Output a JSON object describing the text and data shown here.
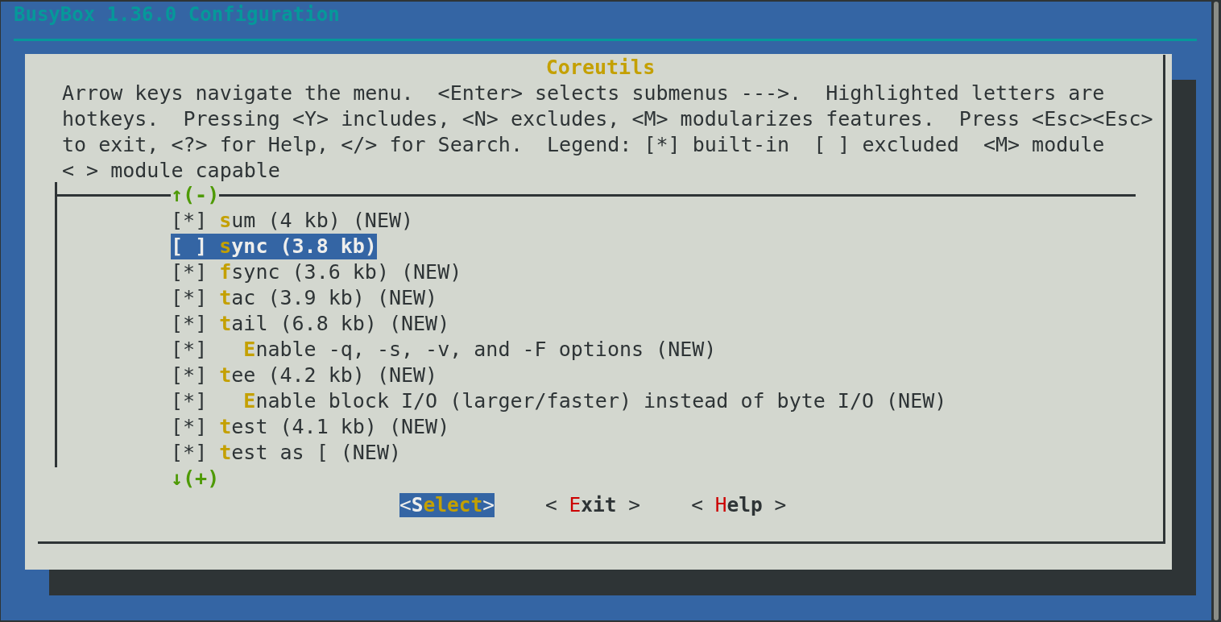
{
  "window": {
    "title": "BusyBox 1.36.0 Configuration"
  },
  "dialog": {
    "title": "Coreutils",
    "help": [
      "Arrow keys navigate the menu.  <Enter> selects submenus --->.  Highlighted letters are",
      "hotkeys.  Pressing <Y> includes, <N> excludes, <M> modularizes features.  Press <Esc><Esc>",
      "to exit, <?> for Help, </> for Search.  Legend: [*] built-in  [ ] excluded  <M> module",
      "< > module capable"
    ]
  },
  "menu": {
    "scroll_up": "↑(-)",
    "scroll_down": "↓(+)",
    "items": [
      {
        "box": "[*]",
        "checked": true,
        "label": "sum (4 kb) (NEW)",
        "selected": false
      },
      {
        "box": "[ ]",
        "checked": false,
        "label": "sync (3.8 kb)",
        "selected": true
      },
      {
        "box": "[*]",
        "checked": true,
        "label": "fsync (3.6 kb) (NEW)",
        "selected": false
      },
      {
        "box": "[*]",
        "checked": true,
        "label": "tac (3.9 kb) (NEW)",
        "selected": false
      },
      {
        "box": "[*]",
        "checked": true,
        "label": "tail (6.8 kb) (NEW)",
        "selected": false,
        "children": [
          {
            "box": "[*]",
            "checked": true,
            "label": "Enable -q, -s, -v, and -F options (NEW)",
            "selected": false
          }
        ]
      },
      {
        "box": "[*]",
        "checked": true,
        "label": "tee (4.2 kb) (NEW)",
        "selected": false,
        "children": [
          {
            "box": "[*]",
            "checked": true,
            "label": "Enable block I/O (larger/faster) instead of byte I/O (NEW)",
            "selected": false
          }
        ]
      },
      {
        "box": "[*]",
        "checked": true,
        "label": "test (4.1 kb) (NEW)",
        "selected": false
      },
      {
        "box": "[*]",
        "checked": true,
        "label": "test as [ (NEW)",
        "selected": false
      }
    ]
  },
  "buttons": [
    {
      "label": "<Select>",
      "selected": true
    },
    {
      "label": "< Exit >",
      "selected": false
    },
    {
      "label": "< Help >",
      "selected": false
    }
  ]
}
